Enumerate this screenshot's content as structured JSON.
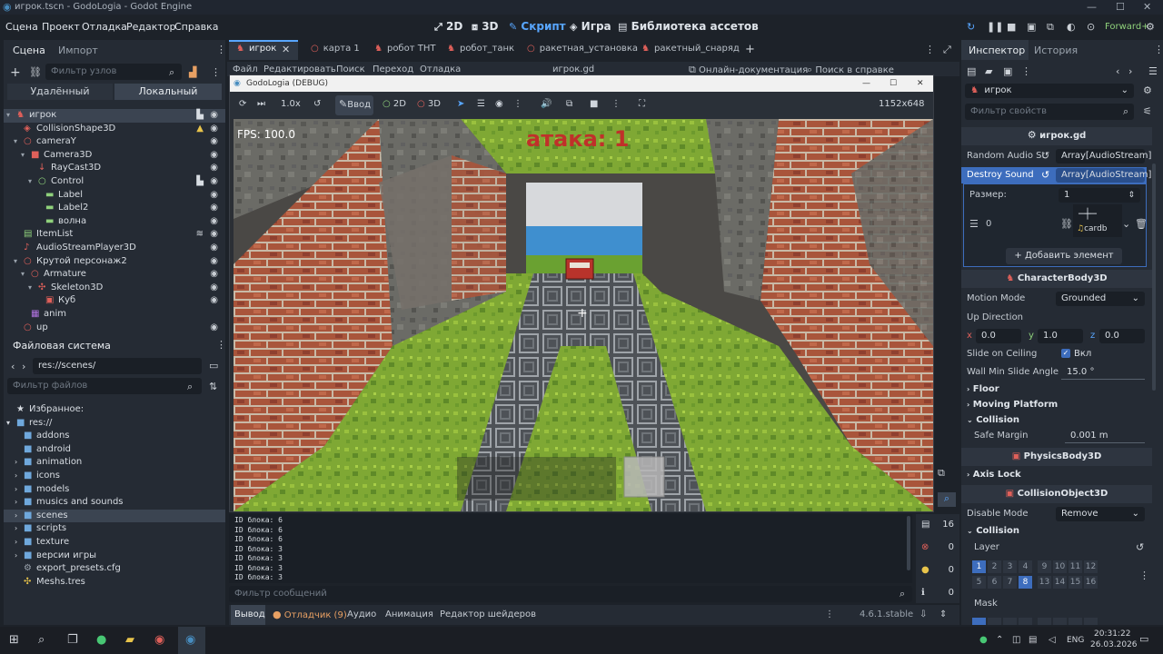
{
  "window": {
    "title": "игрок.tscn - GodoLogia - Godot Engine",
    "controls": [
      "—",
      "☐",
      "✕"
    ]
  },
  "menu": {
    "items": [
      "Сцена",
      "Проект",
      "Отладка",
      "Редактор",
      "Справка"
    ],
    "modes": [
      "2D",
      "3D",
      "Скрипт",
      "Игра",
      "Библиотека ассетов"
    ],
    "renderer": "Forward+"
  },
  "scene_dock": {
    "tabs": [
      "Сцена",
      "Импорт"
    ],
    "filter_placeholder": "Фильтр узлов",
    "subtabs": [
      "Удалённый",
      "Локальный"
    ],
    "nodes": [
      {
        "label": "игрок",
        "indent": 0
      },
      {
        "label": "CollisionShape3D",
        "indent": 1
      },
      {
        "label": "cameraY",
        "indent": 1
      },
      {
        "label": "Camera3D",
        "indent": 2
      },
      {
        "label": "RayCast3D",
        "indent": 3
      },
      {
        "label": "Control",
        "indent": 3
      },
      {
        "label": "Label",
        "indent": 4
      },
      {
        "label": "Label2",
        "indent": 4
      },
      {
        "label": "волна",
        "indent": 4
      },
      {
        "label": "ItemList",
        "indent": 1
      },
      {
        "label": "AudioStreamPlayer3D",
        "indent": 1
      },
      {
        "label": "Крутой персонаж2",
        "indent": 1
      },
      {
        "label": "Armature",
        "indent": 2
      },
      {
        "label": "Skeleton3D",
        "indent": 3
      },
      {
        "label": "Куб",
        "indent": 4
      },
      {
        "label": "anim",
        "indent": 2
      },
      {
        "label": "up",
        "indent": 1
      }
    ]
  },
  "filesystem": {
    "title": "Файловая система",
    "path": "res://scenes/",
    "filter_placeholder": "Фильтр файлов",
    "favorites": "Избранное:",
    "root": "res://",
    "items": [
      "addons",
      "android",
      "animation",
      "icons",
      "models",
      "musics and sounds",
      "scenes",
      "scripts",
      "texture",
      "версии игры",
      "export_presets.cfg",
      "Meshs.tres"
    ]
  },
  "scene_tabs": [
    "игрок",
    "карта 1",
    "робот ТНТ",
    "робот_танк",
    "ракетная_установка",
    "ракетный_снаряд"
  ],
  "script_menu": {
    "items": [
      "Файл",
      "Редактировать",
      "Поиск",
      "Переход",
      "Отладка"
    ],
    "file": "игрок.gd",
    "docs": "Онлайн-документация",
    "help_search": "Поиск в справке"
  },
  "game_window": {
    "title": "GodoLogia (DEBUG)",
    "speed": "1.0x",
    "input_label": "Ввод",
    "mode_2d": "2D",
    "mode_3d": "3D",
    "resolution": "1152x648",
    "fps": "FPS: 100.0",
    "attack": "атака: 1",
    "crosshair": "+"
  },
  "output": {
    "lines": [
      "ID блока: 6",
      "ID блока: 6",
      "ID блока: 6",
      "ID блока: 3",
      "ID блока: 3",
      "ID блока: 3",
      "ID блока: 3"
    ],
    "filter_placeholder": "Фильтр сообщений",
    "counts": {
      "messages": "16",
      "errors": "0",
      "warnings": "0",
      "editor": "0"
    }
  },
  "bottom_tabs": [
    "Вывод",
    "Отладчик (9)",
    "Аудио",
    "Анимация",
    "Редактор шейдеров"
  ],
  "version": "4.6.1.stable",
  "inspector": {
    "tabs": [
      "Инспектор",
      "История"
    ],
    "node": "игрок",
    "filter_placeholder": "Фильтр свойств",
    "script": "игрок.gd",
    "random_audio_label": "Random Audio St",
    "random_audio_value": "Array[AudioStream]",
    "destroy_sound_label": "Destroy Sound",
    "destroy_sound_value": "Array[AudioStream]",
    "size_label": "Размер:",
    "size_value": "1",
    "item_index": "0",
    "item_name": "cardb",
    "add_item": "Добавить элемент",
    "characterbody": "CharacterBody3D",
    "motion_mode_label": "Motion Mode",
    "motion_mode_value": "Grounded",
    "up_direction_label": "Up Direction",
    "up_x": "0.0",
    "up_y": "1.0",
    "up_z": "0.0",
    "slide_ceiling_label": "Slide on Ceiling",
    "slide_ceiling_value": "Вкл",
    "wall_min_label": "Wall Min Slide Angle",
    "wall_min_value": "15.0 °",
    "floor": "Floor",
    "moving_platform": "Moving Platform",
    "collision": "Collision",
    "safe_margin_label": "Safe Margin",
    "safe_margin_value": "0.001 m",
    "physicsbody": "PhysicsBody3D",
    "axis_lock": "Axis Lock",
    "collisionobject": "CollisionObject3D",
    "disable_mode_label": "Disable Mode",
    "disable_mode_value": "Remove",
    "collision2": "Collision",
    "layer_label": "Layer",
    "layers_row1": [
      "1",
      "2",
      "3",
      "4",
      "9",
      "10",
      "11",
      "12"
    ],
    "layers_row2": [
      "5",
      "6",
      "7",
      "8",
      "13",
      "14",
      "15",
      "16"
    ],
    "mask_label": "Mask"
  },
  "taskbar": {
    "lang": "ENG",
    "time": "20:31:22",
    "date": "26.03.2026"
  }
}
